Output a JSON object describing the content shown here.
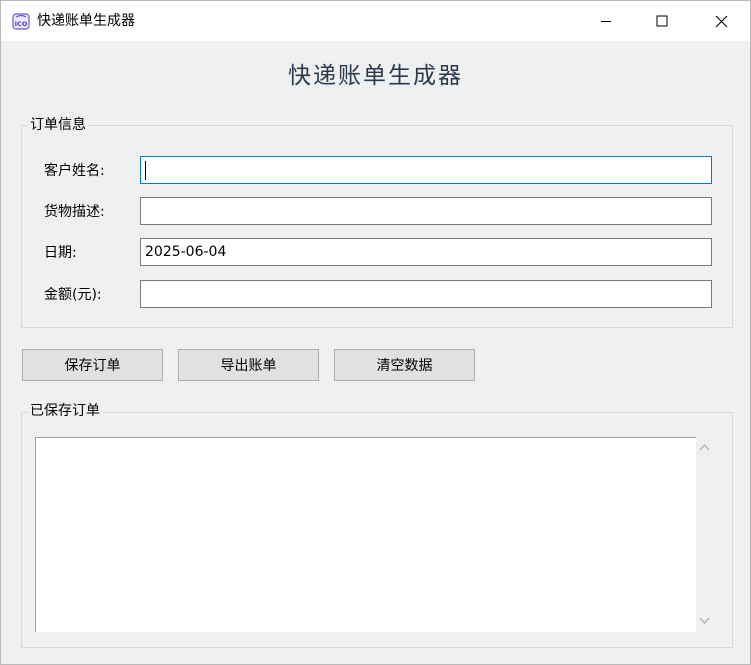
{
  "window": {
    "title": "快递账单生成器",
    "icon": "ico-app-icon"
  },
  "controls": {
    "minimize_icon": "minimize-icon",
    "maximize_icon": "maximize-icon",
    "close_icon": "close-icon"
  },
  "heading": "快递账单生成器",
  "order_info": {
    "legend": "订单信息",
    "fields": {
      "customer_name": {
        "label": "客户姓名:",
        "value": ""
      },
      "goods_description": {
        "label": "货物描述:",
        "value": ""
      },
      "date": {
        "label": "日期:",
        "value": "2025-06-04"
      },
      "amount": {
        "label": "金额(元):",
        "value": ""
      }
    }
  },
  "buttons": {
    "save": "保存订单",
    "export": "导出账单",
    "clear": "清空数据"
  },
  "saved_orders": {
    "legend": "已保存订单",
    "items": []
  },
  "colors": {
    "accent_focus": "#0078d7",
    "heading": "#2b3a4e",
    "background": "#f0f0f0"
  }
}
